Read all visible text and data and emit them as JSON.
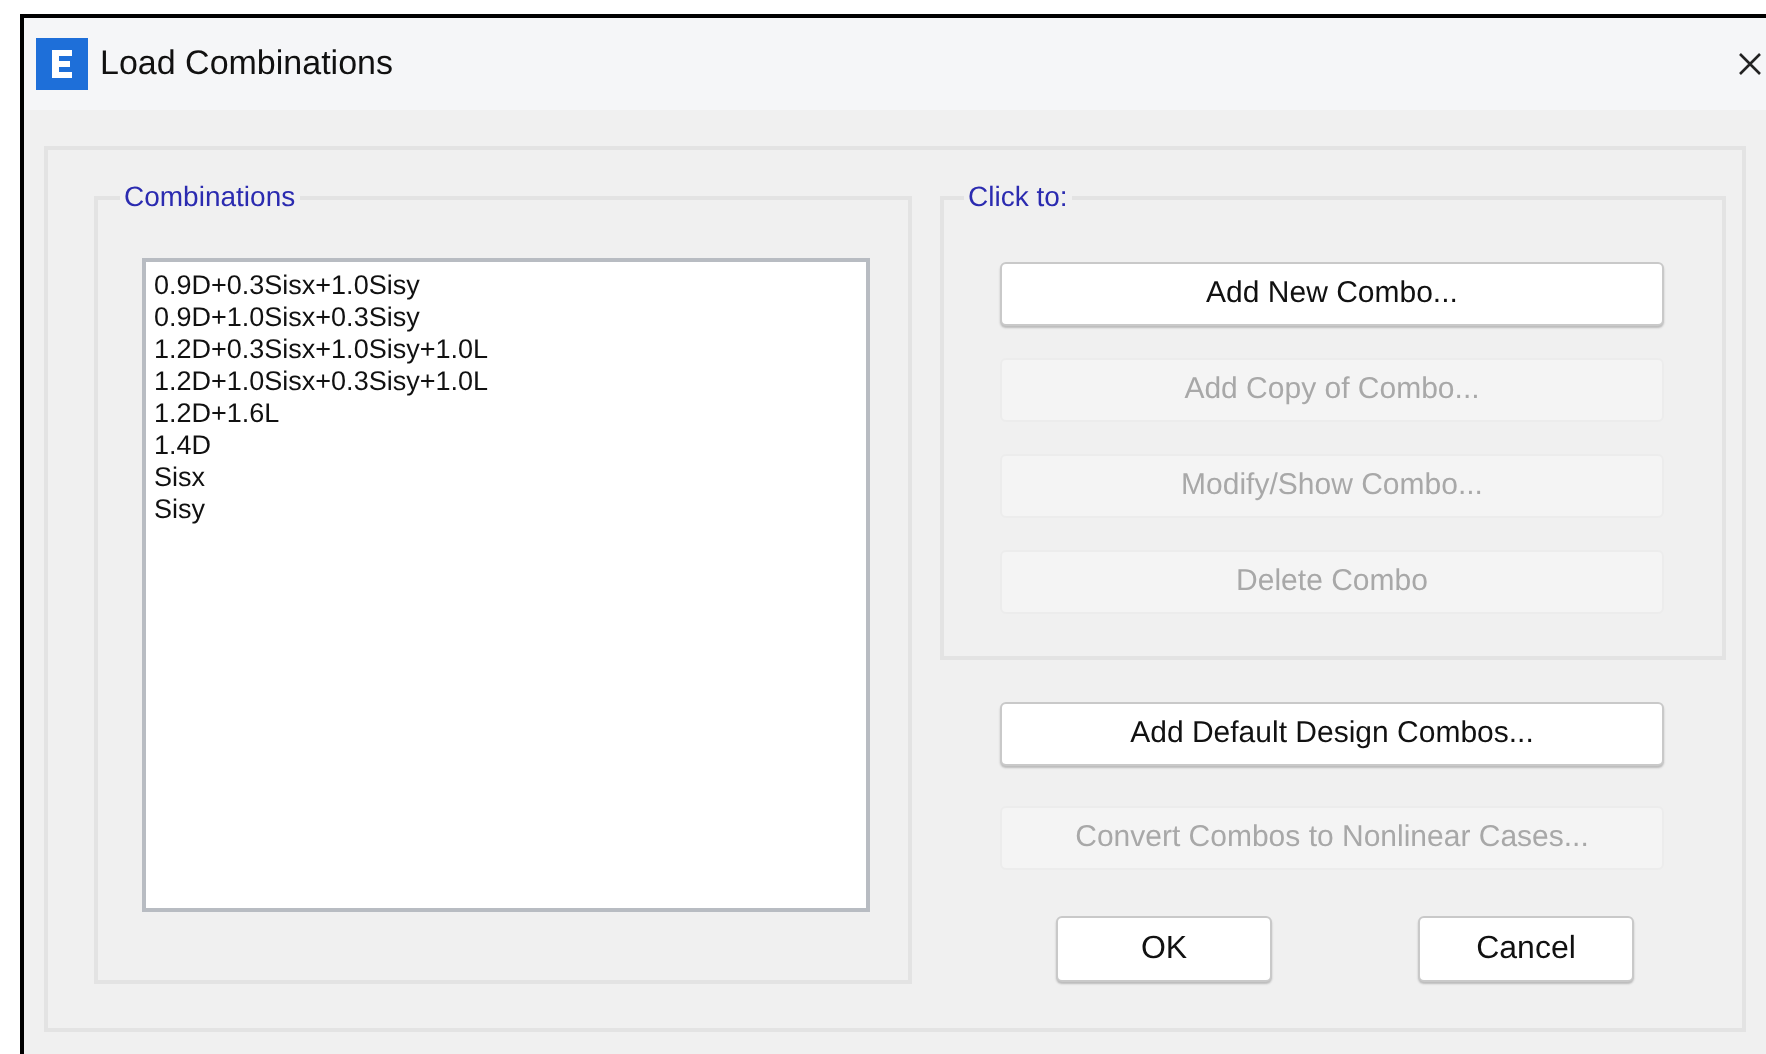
{
  "window": {
    "title": "Load Combinations"
  },
  "combinations": {
    "label": "Combinations",
    "items": [
      "0.9D+0.3Sisx+1.0Sisy",
      "0.9D+1.0Sisx+0.3Sisy",
      "1.2D+0.3Sisx+1.0Sisy+1.0L",
      "1.2D+1.0Sisx+0.3Sisy+1.0L",
      "1.2D+1.6L",
      "1.4D",
      "Sisx",
      "Sisy"
    ]
  },
  "click_to": {
    "label": "Click to:",
    "buttons": [
      {
        "label": "Add New Combo...",
        "disabled": false
      },
      {
        "label": "Add Copy of Combo...",
        "disabled": true
      },
      {
        "label": "Modify/Show Combo...",
        "disabled": true
      },
      {
        "label": "Delete Combo",
        "disabled": true
      }
    ]
  },
  "extra_buttons": [
    {
      "label": "Add Default Design Combos...",
      "disabled": false
    },
    {
      "label": "Convert Combos to Nonlinear Cases...",
      "disabled": true
    }
  ],
  "dialog_buttons": [
    {
      "label": "OK"
    },
    {
      "label": "Cancel"
    }
  ]
}
